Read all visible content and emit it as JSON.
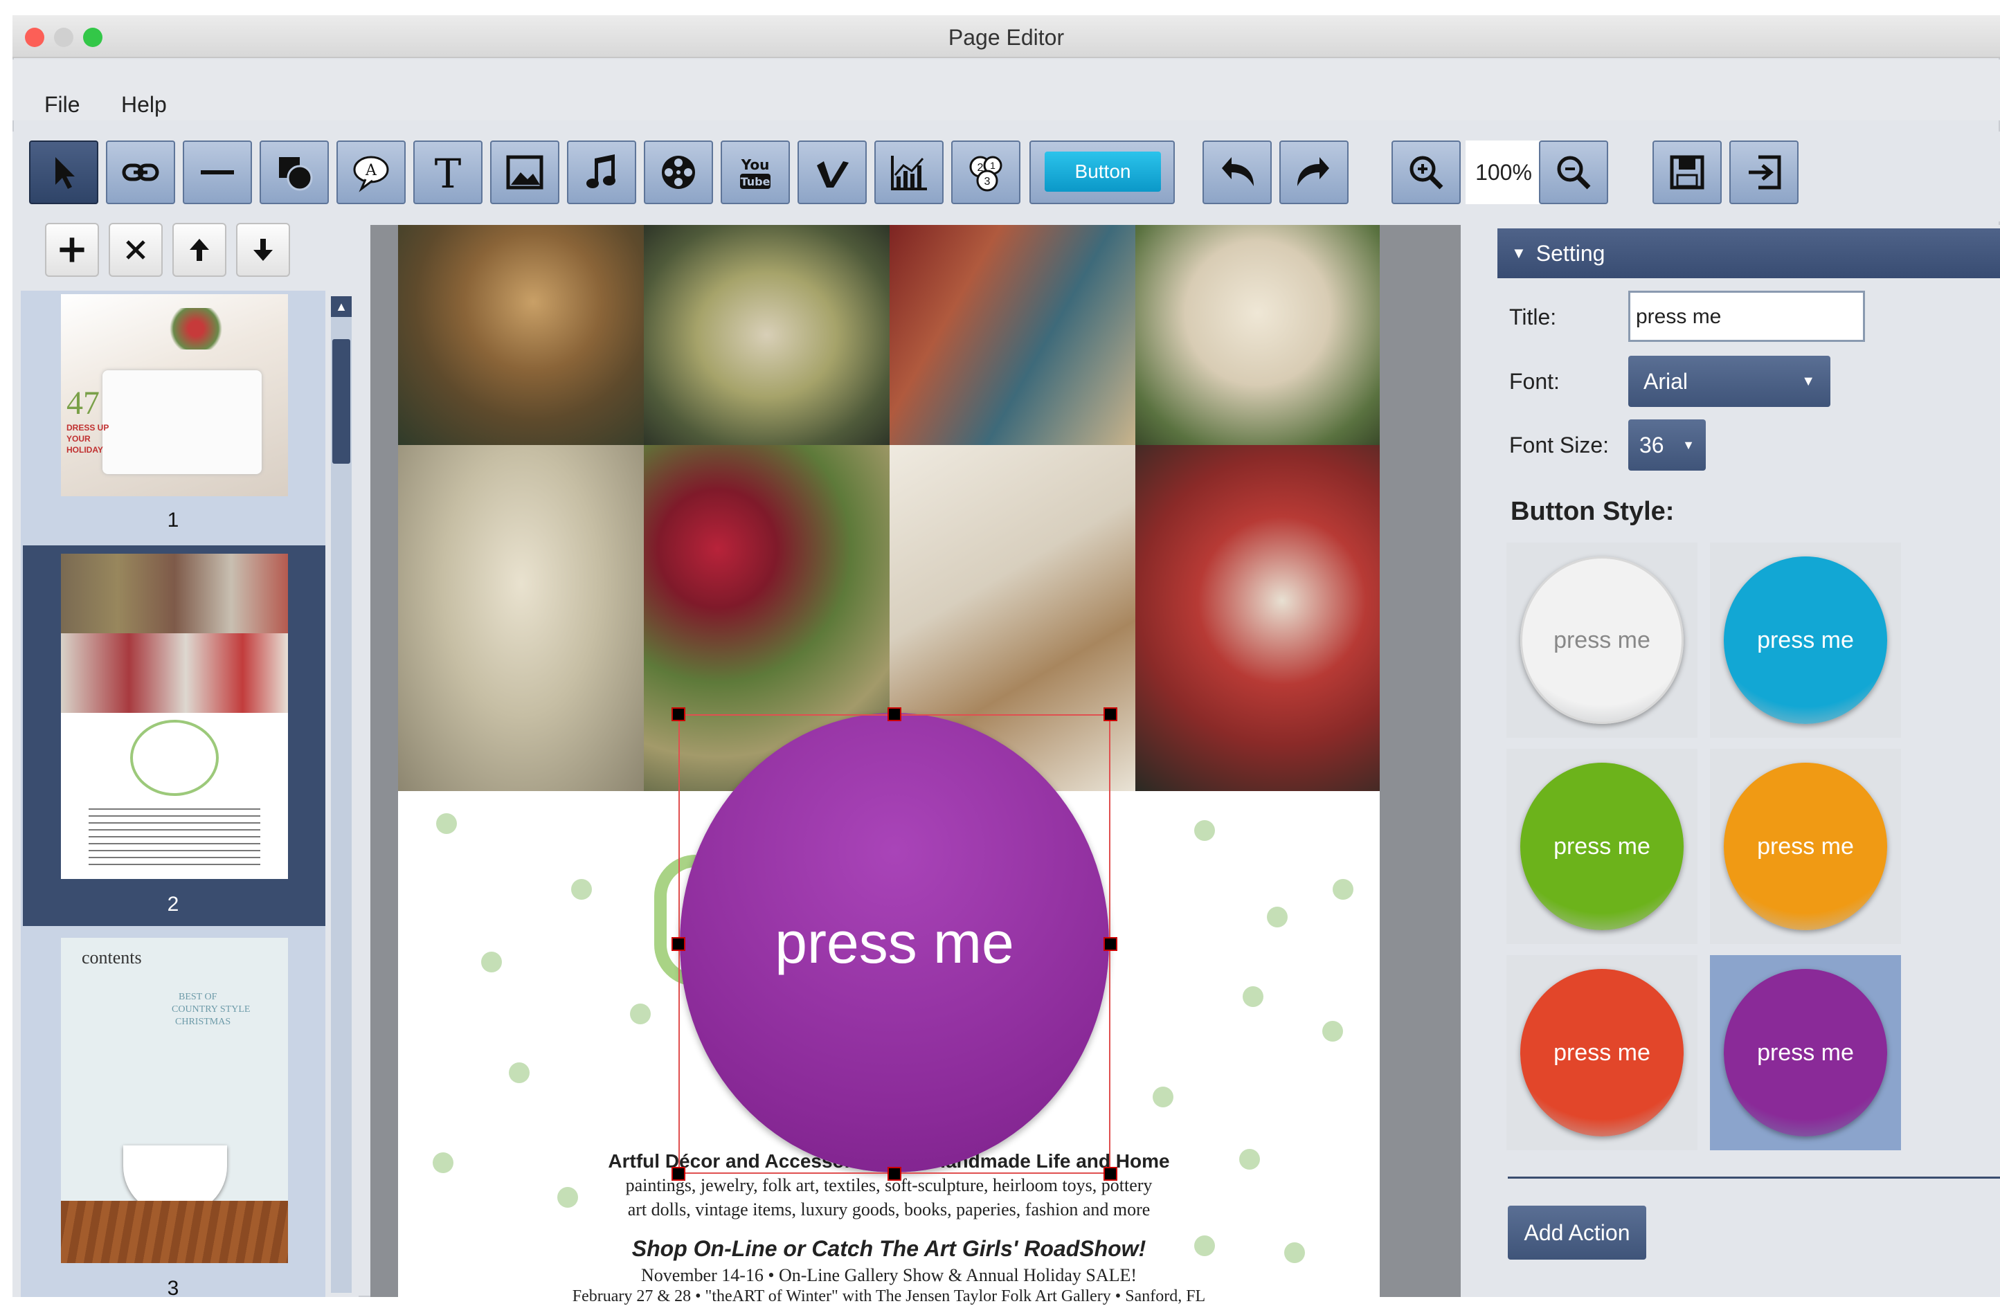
{
  "window": {
    "title": "Page Editor"
  },
  "menu": {
    "file": "File",
    "help": "Help"
  },
  "toolbar": {
    "tools": [
      {
        "name": "select-tool",
        "icon": "arrow-cursor-icon"
      },
      {
        "name": "link-tool",
        "icon": "link-icon"
      },
      {
        "name": "line-tool",
        "icon": "line-icon"
      },
      {
        "name": "shape-tool",
        "icon": "shapes-icon"
      },
      {
        "name": "callout-tool",
        "icon": "callout-icon"
      },
      {
        "name": "text-tool",
        "icon": "text-icon"
      },
      {
        "name": "image-tool",
        "icon": "image-icon"
      },
      {
        "name": "audio-tool",
        "icon": "music-note-icon"
      },
      {
        "name": "video-tool",
        "icon": "film-reel-icon"
      },
      {
        "name": "youtube-tool",
        "icon": "youtube-icon"
      },
      {
        "name": "vimeo-tool",
        "icon": "vimeo-icon"
      },
      {
        "name": "chart-tool",
        "icon": "chart-icon"
      },
      {
        "name": "number-tool",
        "icon": "numbers-icon"
      }
    ],
    "button_tool_label": "Button",
    "zoom": "100%"
  },
  "pages": [
    {
      "number": "1"
    },
    {
      "number": "2"
    },
    {
      "number": "3"
    }
  ],
  "thumb1": {
    "headline": "47",
    "line1": "DRESS UP",
    "line2": "YOUR",
    "line3": "HOLIDAY"
  },
  "thumb3": {
    "title": "contents",
    "line1": "BEST OF",
    "line2": "COUNTRY STYLE",
    "line3": "CHRISTMAS"
  },
  "canvas": {
    "button_label": "press me",
    "line1": "Artful Décor and Accessories for a Handmade Life and Home",
    "line2": "paintings, jewelry, folk art, textiles, soft-sculpture, heirloom toys, pottery",
    "line3": "art dolls, vintage items, luxury goods, books, paperies, fashion and more",
    "line4": "Shop On-Line or Catch The Art Girls' RoadShow!",
    "line5": "November 14-16 • On-Line Gallery Show & Annual Holiday SALE!",
    "line6": "February 27 & 28 • \"theART of Winter\" with The Jensen Taylor Folk Art Gallery • Sanford, FL"
  },
  "settings": {
    "header": "Setting",
    "title_label": "Title:",
    "title_value": "press me",
    "font_label": "Font:",
    "font_value": "Arial",
    "size_label": "Font Size:",
    "size_value": "36",
    "style_heading": "Button Style:",
    "styles": [
      {
        "label": "press me",
        "color": "#f2f2f2",
        "selected": false
      },
      {
        "label": "press me",
        "color": "#12a7d4",
        "selected": false
      },
      {
        "label": "press me",
        "color": "#6cb31b",
        "selected": false
      },
      {
        "label": "press me",
        "color": "#f09a14",
        "selected": false
      },
      {
        "label": "press me",
        "color": "#e2462a",
        "selected": false
      },
      {
        "label": "press me",
        "color": "#8a2a98",
        "selected": true
      }
    ],
    "add_action": "Add Action"
  }
}
